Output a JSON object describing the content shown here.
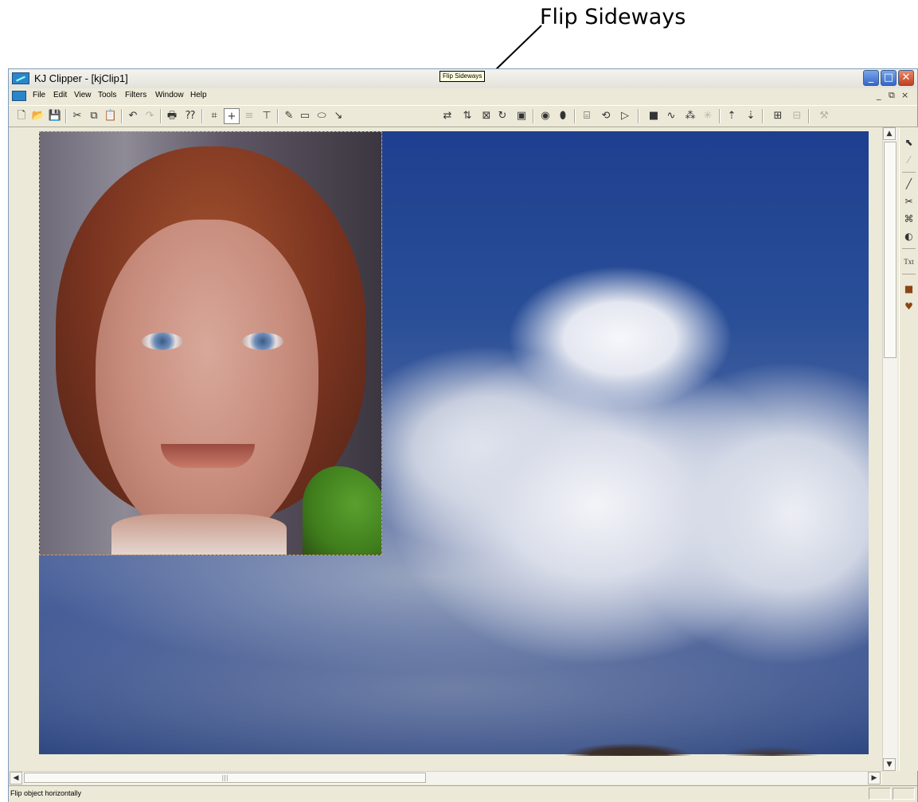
{
  "annotation": {
    "label": "Flip Sideways"
  },
  "window": {
    "title": "KJ Clipper - [kjClip1]",
    "minimize_glyph": "_",
    "maximize_glyph": "□",
    "close_glyph": "✕"
  },
  "menubar": {
    "items": [
      "File",
      "Edit",
      "View",
      "Tools",
      "Filters",
      "Window",
      "Help"
    ],
    "mdi_minimize": "_",
    "mdi_restore": "⧉",
    "mdi_close": "×"
  },
  "toolbar": {
    "buttons": [
      {
        "name": "new-icon",
        "glyph": "🗋"
      },
      {
        "name": "open-icon",
        "glyph": "📂"
      },
      {
        "name": "save-icon",
        "glyph": "💾"
      },
      {
        "name": "cut-icon",
        "glyph": "✂"
      },
      {
        "name": "copy-icon",
        "glyph": "⧉"
      },
      {
        "name": "paste-icon",
        "glyph": "📋"
      },
      {
        "name": "undo-icon",
        "glyph": "↶"
      },
      {
        "name": "redo-icon",
        "glyph": "↷"
      },
      {
        "name": "print-icon",
        "glyph": "🖶"
      },
      {
        "name": "help-pointer-icon",
        "glyph": "⁇"
      },
      {
        "name": "crop-icon",
        "glyph": "⌗"
      },
      {
        "name": "crosshair-icon",
        "glyph": "+"
      },
      {
        "name": "align-icon",
        "glyph": "≡"
      },
      {
        "name": "anchor-icon",
        "glyph": "⊤"
      },
      {
        "name": "pencil-icon",
        "glyph": "✎"
      },
      {
        "name": "rectangle-icon",
        "glyph": "▭"
      },
      {
        "name": "ellipse-icon",
        "glyph": "⬭"
      },
      {
        "name": "line-icon",
        "glyph": "↘"
      },
      {
        "name": "flip-sideways-icon",
        "glyph": "⇄"
      },
      {
        "name": "flip-vertical-icon",
        "glyph": "⇅"
      },
      {
        "name": "mirror-icon",
        "glyph": "⊠"
      },
      {
        "name": "rotate-icon",
        "glyph": "↻"
      },
      {
        "name": "frame-icon",
        "glyph": "▣"
      },
      {
        "name": "color-wheel-icon",
        "glyph": "◉"
      },
      {
        "name": "brush-icon",
        "glyph": "⬮"
      },
      {
        "name": "stamp-icon",
        "glyph": "⌸"
      },
      {
        "name": "refresh-icon",
        "glyph": "⟲"
      },
      {
        "name": "play-icon",
        "glyph": "▷"
      },
      {
        "name": "fill-icon",
        "glyph": "■"
      },
      {
        "name": "wave-icon",
        "glyph": "∿"
      },
      {
        "name": "noise-icon",
        "glyph": "⁂"
      },
      {
        "name": "sparkle-icon",
        "glyph": "✳"
      },
      {
        "name": "bring-front-icon",
        "glyph": "⇡"
      },
      {
        "name": "send-back-icon",
        "glyph": "⇣"
      },
      {
        "name": "group-icon",
        "glyph": "⊞"
      },
      {
        "name": "ungroup-icon",
        "glyph": "⊟"
      },
      {
        "name": "tool-icon",
        "glyph": "⚒"
      }
    ],
    "tooltip": "Flip Sideways"
  },
  "side_toolbar": {
    "tools": [
      {
        "name": "select-tool-icon",
        "glyph": "⬉"
      },
      {
        "name": "dropper-tool-icon",
        "glyph": "⁄"
      },
      {
        "name": "brush-tool-icon",
        "glyph": "╱"
      },
      {
        "name": "scissors-tool-icon",
        "glyph": "✂"
      },
      {
        "name": "clone-tool-icon",
        "glyph": "⌘"
      },
      {
        "name": "color-tool-icon",
        "glyph": "◐"
      },
      {
        "name": "text-tool-icon",
        "glyph": "Txt"
      },
      {
        "name": "square-shape-icon",
        "glyph": "■"
      },
      {
        "name": "heart-shape-icon",
        "glyph": "♥"
      }
    ]
  },
  "scrollbars": {
    "up_arrow": "▲",
    "down_arrow": "▼",
    "left_arrow": "◀",
    "right_arrow": "▶",
    "grip": "|||"
  },
  "status": {
    "text": "Flip object horizontally"
  },
  "colors": {
    "highlight_circle": "#cc1010",
    "arrow": "#000000"
  }
}
